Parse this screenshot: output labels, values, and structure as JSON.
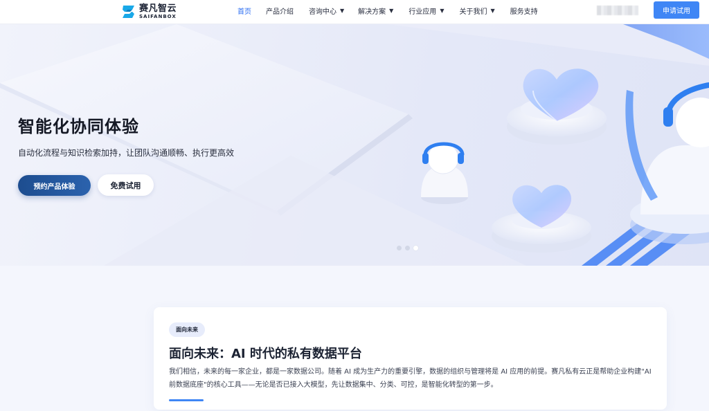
{
  "header": {
    "logo_cn": "赛凡智云",
    "logo_en": "SAIFANBOX",
    "nav": [
      {
        "label": "首页",
        "caret": false,
        "active": true
      },
      {
        "label": "产品介绍",
        "caret": false,
        "active": false
      },
      {
        "label": "咨询中心",
        "caret": true,
        "active": false
      },
      {
        "label": "解决方案",
        "caret": true,
        "active": false
      },
      {
        "label": "行业应用",
        "caret": true,
        "active": false
      },
      {
        "label": "关于我们",
        "caret": true,
        "active": false
      },
      {
        "label": "服务支持",
        "caret": false,
        "active": false
      }
    ],
    "caret_glyph": "▼",
    "apply_label": "申请试用"
  },
  "hero": {
    "title": "智能化协同体验",
    "subtitle": "自动化流程与知识检索加持，让团队沟通顺畅、执行更高效",
    "primary_button": "预约产品体验",
    "secondary_button": "免费试用",
    "slides_total": 3,
    "slide_active": 3
  },
  "card": {
    "tag": "面向未来",
    "title": "面向未来：AI 时代的私有数据平台",
    "paragraph": "我们相信，未来的每一家企业，都是一家数据公司。随着 AI 成为生产力的重要引擎，数据的组织与管理将是 AI 应用的前提。赛凡私有云正是帮助企业构建\"AI 前数据底座\"的核心工具——无论是否已接入大模型，先让数据集中、分类、可控，是智能化转型的第一步。"
  },
  "colors": {
    "accent": "#3f86f5",
    "nav_active": "#2b6df2",
    "primary_button": "#1d4d8f"
  }
}
